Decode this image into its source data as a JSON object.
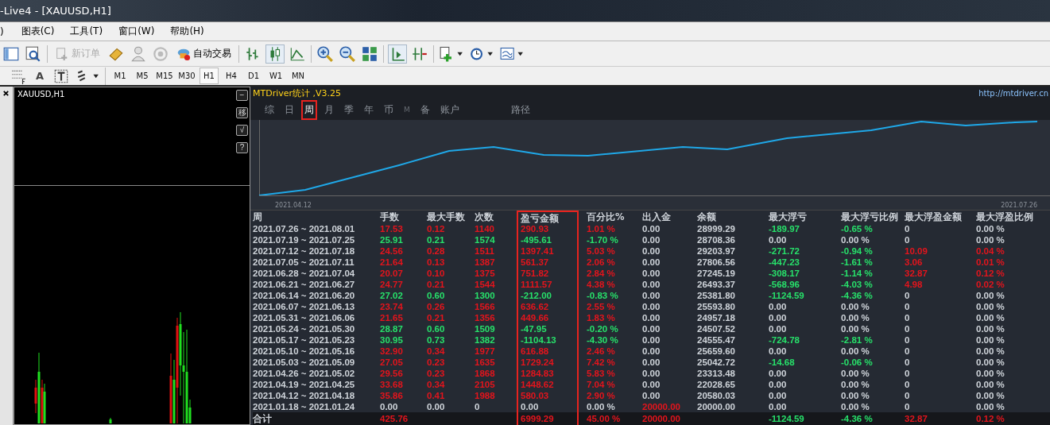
{
  "window": {
    "title": "-Live4 - [XAUUSD,H1]"
  },
  "menu": [
    ")",
    "图表(C)",
    "工具(T)",
    "窗口(W)",
    "帮助(H)"
  ],
  "toolbar": {
    "buttons": [
      {
        "label": "新订单",
        "disabled": true
      },
      {
        "label": "自动交易",
        "disabled": false
      }
    ]
  },
  "drawing_toolbar": {
    "text_tool": "A"
  },
  "timeframes": [
    {
      "label": "M1",
      "selected": false
    },
    {
      "label": "M5",
      "selected": false
    },
    {
      "label": "M15",
      "selected": false
    },
    {
      "label": "M30",
      "selected": false
    },
    {
      "label": "H1",
      "selected": true
    },
    {
      "label": "H4",
      "selected": false
    },
    {
      "label": "D1",
      "selected": false
    },
    {
      "label": "W1",
      "selected": false
    },
    {
      "label": "MN",
      "selected": false
    }
  ],
  "chart_window": {
    "title": "XAUUSD,H1",
    "buttons": [
      "−",
      "移",
      "√",
      "?"
    ]
  },
  "stats": {
    "title": "MTDriver统计 ,V3.25",
    "link": "http://mtdriver.cn",
    "tabs": [
      {
        "label": "综",
        "selected": false,
        "highlighted": false,
        "dim": false
      },
      {
        "label": "日",
        "selected": false,
        "highlighted": false,
        "dim": false
      },
      {
        "label": "周",
        "selected": true,
        "highlighted": true,
        "dim": false
      },
      {
        "label": "月",
        "selected": false,
        "highlighted": false,
        "dim": false
      },
      {
        "label": "季",
        "selected": false,
        "highlighted": false,
        "dim": false
      },
      {
        "label": "年",
        "selected": false,
        "highlighted": false,
        "dim": false
      },
      {
        "label": "币",
        "selected": false,
        "highlighted": false,
        "dim": false
      },
      {
        "label": "M",
        "selected": false,
        "highlighted": false,
        "dim": true
      },
      {
        "label": "备",
        "selected": false,
        "highlighted": false,
        "dim": false
      },
      {
        "label": "账户",
        "selected": false,
        "highlighted": false,
        "dim": false
      },
      {
        "label": "路径",
        "selected": false,
        "highlighted": false,
        "dim": false
      }
    ],
    "chart_labels": [
      "2021.04.12",
      "2021.07.26"
    ],
    "table": {
      "columns": [
        {
          "label": "周",
          "highlighted": false
        },
        {
          "label": "手数",
          "highlighted": false
        },
        {
          "label": "最大手数",
          "highlighted": false
        },
        {
          "label": "次数",
          "highlighted": false
        },
        {
          "label": "盈亏金额",
          "highlighted": true
        },
        {
          "label": "百分比%",
          "highlighted": false
        },
        {
          "label": "出入金",
          "highlighted": false
        },
        {
          "label": "余额",
          "highlighted": false
        },
        {
          "label": "最大浮亏",
          "highlighted": false
        },
        {
          "label": "最大浮亏比例",
          "highlighted": false
        },
        {
          "label": "最大浮盈金额",
          "highlighted": false
        },
        {
          "label": "最大浮盈比例",
          "highlighted": false
        }
      ],
      "rows": [
        {
          "cells": [
            {
              "text": "2021.07.26 ~ 2021.08.01",
              "color": "#cfd4da"
            },
            {
              "text": "17.53",
              "color": "#e4141c"
            },
            {
              "text": "0.12",
              "color": "#e4141c"
            },
            {
              "text": "1140",
              "color": "#e4141c"
            },
            {
              "text": "290.93",
              "color": "#e4141c"
            },
            {
              "text": "1.01 %",
              "color": "#e4141c"
            },
            {
              "text": "0.00",
              "color": "#cfd4da"
            },
            {
              "text": "28999.29",
              "color": "#cfd4da"
            },
            {
              "text": "-189.97",
              "color": "#27e06a"
            },
            {
              "text": "-0.65 %",
              "color": "#27e06a"
            },
            {
              "text": "0",
              "color": "#cfd4da"
            },
            {
              "text": "0.00 %",
              "color": "#cfd4da"
            }
          ]
        },
        {
          "cells": [
            {
              "text": "2021.07.19 ~ 2021.07.25",
              "color": "#cfd4da"
            },
            {
              "text": "25.91",
              "color": "#27e06a"
            },
            {
              "text": "0.21",
              "color": "#27e06a"
            },
            {
              "text": "1574",
              "color": "#27e06a"
            },
            {
              "text": "-495.61",
              "color": "#27e06a"
            },
            {
              "text": "-1.70 %",
              "color": "#27e06a"
            },
            {
              "text": "0.00",
              "color": "#cfd4da"
            },
            {
              "text": "28708.36",
              "color": "#cfd4da"
            },
            {
              "text": "0.00",
              "color": "#cfd4da"
            },
            {
              "text": "0.00 %",
              "color": "#cfd4da"
            },
            {
              "text": "0",
              "color": "#cfd4da"
            },
            {
              "text": "0.00 %",
              "color": "#cfd4da"
            }
          ]
        },
        {
          "cells": [
            {
              "text": "2021.07.12 ~ 2021.07.18",
              "color": "#cfd4da"
            },
            {
              "text": "24.56",
              "color": "#e4141c"
            },
            {
              "text": "0.28",
              "color": "#e4141c"
            },
            {
              "text": "1511",
              "color": "#e4141c"
            },
            {
              "text": "1397.41",
              "color": "#e4141c"
            },
            {
              "text": "5.03 %",
              "color": "#e4141c"
            },
            {
              "text": "0.00",
              "color": "#cfd4da"
            },
            {
              "text": "29203.97",
              "color": "#cfd4da"
            },
            {
              "text": "-271.72",
              "color": "#27e06a"
            },
            {
              "text": "-0.94 %",
              "color": "#27e06a"
            },
            {
              "text": "10.09",
              "color": "#e4141c"
            },
            {
              "text": "0.04 %",
              "color": "#e4141c"
            }
          ]
        },
        {
          "cells": [
            {
              "text": "2021.07.05 ~ 2021.07.11",
              "color": "#cfd4da"
            },
            {
              "text": "21.64",
              "color": "#e4141c"
            },
            {
              "text": "0.13",
              "color": "#e4141c"
            },
            {
              "text": "1387",
              "color": "#e4141c"
            },
            {
              "text": "561.37",
              "color": "#e4141c"
            },
            {
              "text": "2.06 %",
              "color": "#e4141c"
            },
            {
              "text": "0.00",
              "color": "#cfd4da"
            },
            {
              "text": "27806.56",
              "color": "#cfd4da"
            },
            {
              "text": "-447.23",
              "color": "#27e06a"
            },
            {
              "text": "-1.61 %",
              "color": "#27e06a"
            },
            {
              "text": "3.06",
              "color": "#e4141c"
            },
            {
              "text": "0.01 %",
              "color": "#e4141c"
            }
          ]
        },
        {
          "cells": [
            {
              "text": "2021.06.28 ~ 2021.07.04",
              "color": "#cfd4da"
            },
            {
              "text": "20.07",
              "color": "#e4141c"
            },
            {
              "text": "0.10",
              "color": "#e4141c"
            },
            {
              "text": "1375",
              "color": "#e4141c"
            },
            {
              "text": "751.82",
              "color": "#e4141c"
            },
            {
              "text": "2.84 %",
              "color": "#e4141c"
            },
            {
              "text": "0.00",
              "color": "#cfd4da"
            },
            {
              "text": "27245.19",
              "color": "#cfd4da"
            },
            {
              "text": "-308.17",
              "color": "#27e06a"
            },
            {
              "text": "-1.14 %",
              "color": "#27e06a"
            },
            {
              "text": "32.87",
              "color": "#e4141c"
            },
            {
              "text": "0.12 %",
              "color": "#e4141c"
            }
          ]
        },
        {
          "cells": [
            {
              "text": "2021.06.21 ~ 2021.06.27",
              "color": "#cfd4da"
            },
            {
              "text": "24.77",
              "color": "#e4141c"
            },
            {
              "text": "0.21",
              "color": "#e4141c"
            },
            {
              "text": "1544",
              "color": "#e4141c"
            },
            {
              "text": "1111.57",
              "color": "#e4141c"
            },
            {
              "text": "4.38 %",
              "color": "#e4141c"
            },
            {
              "text": "0.00",
              "color": "#cfd4da"
            },
            {
              "text": "26493.37",
              "color": "#cfd4da"
            },
            {
              "text": "-568.96",
              "color": "#27e06a"
            },
            {
              "text": "-4.03 %",
              "color": "#27e06a"
            },
            {
              "text": "4.98",
              "color": "#e4141c"
            },
            {
              "text": "0.02 %",
              "color": "#e4141c"
            }
          ]
        },
        {
          "cells": [
            {
              "text": "2021.06.14 ~ 2021.06.20",
              "color": "#cfd4da"
            },
            {
              "text": "27.02",
              "color": "#27e06a"
            },
            {
              "text": "0.60",
              "color": "#27e06a"
            },
            {
              "text": "1300",
              "color": "#27e06a"
            },
            {
              "text": "-212.00",
              "color": "#27e06a"
            },
            {
              "text": "-0.83 %",
              "color": "#27e06a"
            },
            {
              "text": "0.00",
              "color": "#cfd4da"
            },
            {
              "text": "25381.80",
              "color": "#cfd4da"
            },
            {
              "text": "-1124.59",
              "color": "#27e06a"
            },
            {
              "text": "-4.36 %",
              "color": "#27e06a"
            },
            {
              "text": "0",
              "color": "#cfd4da"
            },
            {
              "text": "0.00 %",
              "color": "#cfd4da"
            }
          ]
        },
        {
          "cells": [
            {
              "text": "2021.06.07 ~ 2021.06.13",
              "color": "#cfd4da"
            },
            {
              "text": "23.74",
              "color": "#e4141c"
            },
            {
              "text": "0.26",
              "color": "#e4141c"
            },
            {
              "text": "1566",
              "color": "#e4141c"
            },
            {
              "text": "636.62",
              "color": "#e4141c"
            },
            {
              "text": "2.55 %",
              "color": "#e4141c"
            },
            {
              "text": "0.00",
              "color": "#cfd4da"
            },
            {
              "text": "25593.80",
              "color": "#cfd4da"
            },
            {
              "text": "0.00",
              "color": "#cfd4da"
            },
            {
              "text": "0.00 %",
              "color": "#cfd4da"
            },
            {
              "text": "0",
              "color": "#cfd4da"
            },
            {
              "text": "0.00 %",
              "color": "#cfd4da"
            }
          ]
        },
        {
          "cells": [
            {
              "text": "2021.05.31 ~ 2021.06.06",
              "color": "#cfd4da"
            },
            {
              "text": "21.65",
              "color": "#e4141c"
            },
            {
              "text": "0.21",
              "color": "#e4141c"
            },
            {
              "text": "1356",
              "color": "#e4141c"
            },
            {
              "text": "449.66",
              "color": "#e4141c"
            },
            {
              "text": "1.83 %",
              "color": "#e4141c"
            },
            {
              "text": "0.00",
              "color": "#cfd4da"
            },
            {
              "text": "24957.18",
              "color": "#cfd4da"
            },
            {
              "text": "0.00",
              "color": "#cfd4da"
            },
            {
              "text": "0.00 %",
              "color": "#cfd4da"
            },
            {
              "text": "0",
              "color": "#cfd4da"
            },
            {
              "text": "0.00 %",
              "color": "#cfd4da"
            }
          ]
        },
        {
          "cells": [
            {
              "text": "2021.05.24 ~ 2021.05.30",
              "color": "#cfd4da"
            },
            {
              "text": "28.87",
              "color": "#27e06a"
            },
            {
              "text": "0.60",
              "color": "#27e06a"
            },
            {
              "text": "1509",
              "color": "#27e06a"
            },
            {
              "text": "-47.95",
              "color": "#27e06a"
            },
            {
              "text": "-0.20 %",
              "color": "#27e06a"
            },
            {
              "text": "0.00",
              "color": "#cfd4da"
            },
            {
              "text": "24507.52",
              "color": "#cfd4da"
            },
            {
              "text": "0.00",
              "color": "#cfd4da"
            },
            {
              "text": "0.00 %",
              "color": "#cfd4da"
            },
            {
              "text": "0",
              "color": "#cfd4da"
            },
            {
              "text": "0.00 %",
              "color": "#cfd4da"
            }
          ]
        },
        {
          "cells": [
            {
              "text": "2021.05.17 ~ 2021.05.23",
              "color": "#cfd4da"
            },
            {
              "text": "30.95",
              "color": "#27e06a"
            },
            {
              "text": "0.73",
              "color": "#27e06a"
            },
            {
              "text": "1382",
              "color": "#27e06a"
            },
            {
              "text": "-1104.13",
              "color": "#27e06a"
            },
            {
              "text": "-4.30 %",
              "color": "#27e06a"
            },
            {
              "text": "0.00",
              "color": "#cfd4da"
            },
            {
              "text": "24555.47",
              "color": "#cfd4da"
            },
            {
              "text": "-724.78",
              "color": "#27e06a"
            },
            {
              "text": "-2.81 %",
              "color": "#27e06a"
            },
            {
              "text": "0",
              "color": "#cfd4da"
            },
            {
              "text": "0.00 %",
              "color": "#cfd4da"
            }
          ]
        },
        {
          "cells": [
            {
              "text": "2021.05.10 ~ 2021.05.16",
              "color": "#cfd4da"
            },
            {
              "text": "32.90",
              "color": "#e4141c"
            },
            {
              "text": "0.34",
              "color": "#e4141c"
            },
            {
              "text": "1977",
              "color": "#e4141c"
            },
            {
              "text": "616.88",
              "color": "#e4141c"
            },
            {
              "text": "2.46 %",
              "color": "#e4141c"
            },
            {
              "text": "0.00",
              "color": "#cfd4da"
            },
            {
              "text": "25659.60",
              "color": "#cfd4da"
            },
            {
              "text": "0.00",
              "color": "#cfd4da"
            },
            {
              "text": "0.00 %",
              "color": "#cfd4da"
            },
            {
              "text": "0",
              "color": "#cfd4da"
            },
            {
              "text": "0.00 %",
              "color": "#cfd4da"
            }
          ]
        },
        {
          "cells": [
            {
              "text": "2021.05.03 ~ 2021.05.09",
              "color": "#cfd4da"
            },
            {
              "text": "27.05",
              "color": "#e4141c"
            },
            {
              "text": "0.23",
              "color": "#e4141c"
            },
            {
              "text": "1635",
              "color": "#e4141c"
            },
            {
              "text": "1729.24",
              "color": "#e4141c"
            },
            {
              "text": "7.42 %",
              "color": "#e4141c"
            },
            {
              "text": "0.00",
              "color": "#cfd4da"
            },
            {
              "text": "25042.72",
              "color": "#cfd4da"
            },
            {
              "text": "-14.68",
              "color": "#27e06a"
            },
            {
              "text": "-0.06 %",
              "color": "#27e06a"
            },
            {
              "text": "0",
              "color": "#cfd4da"
            },
            {
              "text": "0.00 %",
              "color": "#cfd4da"
            }
          ]
        },
        {
          "cells": [
            {
              "text": "2021.04.26 ~ 2021.05.02",
              "color": "#cfd4da"
            },
            {
              "text": "29.56",
              "color": "#e4141c"
            },
            {
              "text": "0.23",
              "color": "#e4141c"
            },
            {
              "text": "1868",
              "color": "#e4141c"
            },
            {
              "text": "1284.83",
              "color": "#e4141c"
            },
            {
              "text": "5.83 %",
              "color": "#e4141c"
            },
            {
              "text": "0.00",
              "color": "#cfd4da"
            },
            {
              "text": "23313.48",
              "color": "#cfd4da"
            },
            {
              "text": "0.00",
              "color": "#cfd4da"
            },
            {
              "text": "0.00 %",
              "color": "#cfd4da"
            },
            {
              "text": "0",
              "color": "#cfd4da"
            },
            {
              "text": "0.00 %",
              "color": "#cfd4da"
            }
          ]
        },
        {
          "cells": [
            {
              "text": "2021.04.19 ~ 2021.04.25",
              "color": "#cfd4da"
            },
            {
              "text": "33.68",
              "color": "#e4141c"
            },
            {
              "text": "0.34",
              "color": "#e4141c"
            },
            {
              "text": "2105",
              "color": "#e4141c"
            },
            {
              "text": "1448.62",
              "color": "#e4141c"
            },
            {
              "text": "7.04 %",
              "color": "#e4141c"
            },
            {
              "text": "0.00",
              "color": "#cfd4da"
            },
            {
              "text": "22028.65",
              "color": "#cfd4da"
            },
            {
              "text": "0.00",
              "color": "#cfd4da"
            },
            {
              "text": "0.00 %",
              "color": "#cfd4da"
            },
            {
              "text": "0",
              "color": "#cfd4da"
            },
            {
              "text": "0.00 %",
              "color": "#cfd4da"
            }
          ]
        },
        {
          "cells": [
            {
              "text": "2021.04.12 ~ 2021.04.18",
              "color": "#cfd4da"
            },
            {
              "text": "35.86",
              "color": "#e4141c"
            },
            {
              "text": "0.41",
              "color": "#e4141c"
            },
            {
              "text": "1988",
              "color": "#e4141c"
            },
            {
              "text": "580.03",
              "color": "#e4141c"
            },
            {
              "text": "2.90 %",
              "color": "#e4141c"
            },
            {
              "text": "0.00",
              "color": "#cfd4da"
            },
            {
              "text": "20580.03",
              "color": "#cfd4da"
            },
            {
              "text": "0.00",
              "color": "#cfd4da"
            },
            {
              "text": "0.00 %",
              "color": "#cfd4da"
            },
            {
              "text": "0",
              "color": "#cfd4da"
            },
            {
              "text": "0.00 %",
              "color": "#cfd4da"
            }
          ]
        },
        {
          "cells": [
            {
              "text": "2021.01.18 ~ 2021.01.24",
              "color": "#cfd4da"
            },
            {
              "text": "0.00",
              "color": "#cfd4da"
            },
            {
              "text": "0.00",
              "color": "#cfd4da"
            },
            {
              "text": "0",
              "color": "#cfd4da"
            },
            {
              "text": "0.00",
              "color": "#cfd4da"
            },
            {
              "text": "0.00 %",
              "color": "#cfd4da"
            },
            {
              "text": "20000.00",
              "color": "#e4141c"
            },
            {
              "text": "20000.00",
              "color": "#cfd4da"
            },
            {
              "text": "0.00",
              "color": "#cfd4da"
            },
            {
              "text": "0.00 %",
              "color": "#cfd4da"
            },
            {
              "text": "0",
              "color": "#cfd4da"
            },
            {
              "text": "0.00 %",
              "color": "#cfd4da"
            }
          ]
        }
      ],
      "total": {
        "cells": [
          {
            "text": "合计",
            "color": "#cfd4da"
          },
          {
            "text": "425.76",
            "color": "#e4141c"
          },
          {},
          {},
          {
            "text": "6999.29",
            "color": "#e4141c"
          },
          {
            "text": "45.00 %",
            "color": "#e4141c"
          },
          {
            "text": "20000.00",
            "color": "#e4141c"
          },
          {},
          {
            "text": "-1124.59",
            "color": "#27e06a"
          },
          {
            "text": "-4.36 %",
            "color": "#27e06a"
          },
          {
            "text": "32.87",
            "color": "#e4141c"
          },
          {
            "text": "0.12 %",
            "color": "#e4141c"
          }
        ]
      }
    }
  }
}
